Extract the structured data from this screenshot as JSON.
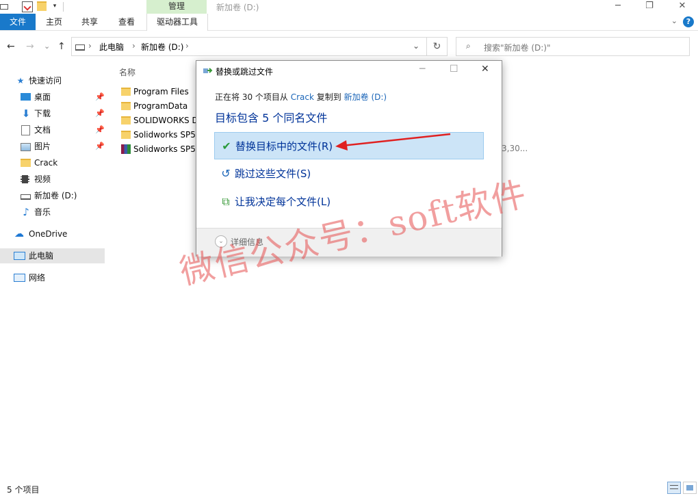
{
  "window": {
    "title": "新加卷 (D:)",
    "context_tab_group": "管理",
    "min_glyph": "─",
    "max_glyph": "❐",
    "close_glyph": "✕"
  },
  "ribbon": {
    "tabs": [
      "文件",
      "主页",
      "共享",
      "查看",
      "驱动器工具"
    ],
    "collapse_glyph": "⌄",
    "help_glyph": "?"
  },
  "address": {
    "back_glyph": "←",
    "forward_glyph": "→",
    "recent_glyph": "⌄",
    "up_glyph": "↑",
    "crumbs": [
      "此电脑",
      "新加卷 (D:)"
    ],
    "sep_glyph": "›",
    "dropdown_glyph": "⌄",
    "refresh_glyph": "↻",
    "search_placeholder": "搜索\"新加卷 (D:)\"",
    "search_glyph": "⌕"
  },
  "sidebar": {
    "quick_access": "快速访问",
    "pin_glyph": "📌",
    "items": [
      {
        "label": "桌面",
        "pinned": true
      },
      {
        "label": "下载",
        "pinned": true
      },
      {
        "label": "文档",
        "pinned": true
      },
      {
        "label": "图片",
        "pinned": true
      },
      {
        "label": "Crack",
        "pinned": false
      },
      {
        "label": "视频",
        "pinned": false
      },
      {
        "label": "新加卷 (D:)",
        "pinned": false
      },
      {
        "label": "音乐",
        "pinned": false
      }
    ],
    "onedrive": "OneDrive",
    "this_pc": "此电脑",
    "network": "网络"
  },
  "filelist": {
    "column_name": "名称",
    "rows": [
      {
        "name": "Program Files",
        "icon": "folder-icon"
      },
      {
        "name": "ProgramData",
        "icon": "folder-icon"
      },
      {
        "name": "SOLIDWORKS D",
        "icon": "folder-icon"
      },
      {
        "name": "Solidworks SP5",
        "icon": "folder-icon"
      },
      {
        "name": "Solidworks SP5",
        "icon": "rar-archive-icon"
      }
    ],
    "row5_date_fragment": "3,30..."
  },
  "dialog": {
    "title": "替换或跳过文件",
    "copy_prefix": "正在将 30 个项目从",
    "copy_source": "Crack",
    "copy_mid": "复制到",
    "copy_dest": "新加卷 (D:)",
    "heading": "目标包含 5 个同名文件",
    "options": [
      {
        "label": "替换目标中的文件(R)",
        "glyph": "✔"
      },
      {
        "label": "跳过这些文件(S)",
        "glyph": "↺"
      },
      {
        "label": "让我决定每个文件(L)",
        "glyph": "⧉"
      }
    ],
    "details_label": "详细信息",
    "details_glyph": "⌄",
    "min_glyph": "─",
    "max_glyph": "☐",
    "close_glyph": "✕"
  },
  "status": {
    "item_count": "5 个项目"
  },
  "watermark": "微信公众号：soft软件",
  "colors": {
    "accent": "#1979ca",
    "annotation_arrow": "#e02020"
  }
}
